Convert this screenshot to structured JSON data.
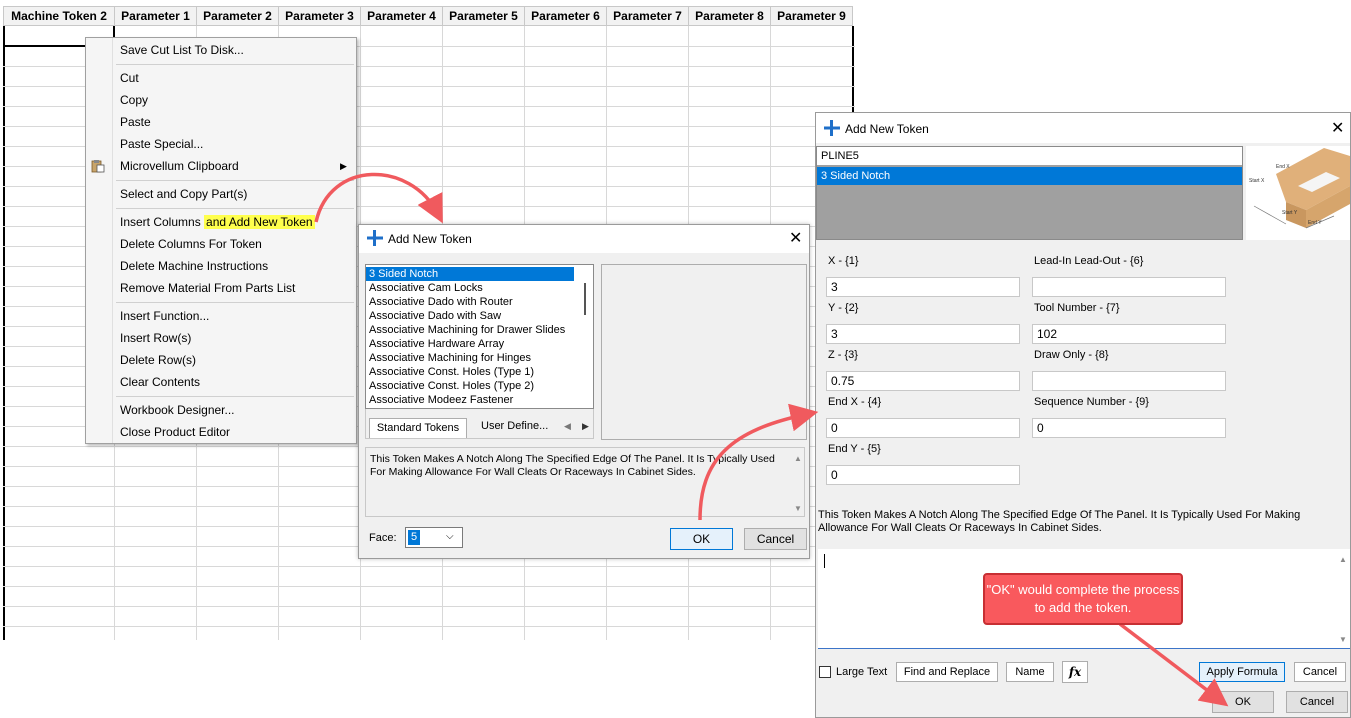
{
  "sheet": {
    "headers": [
      "Machine Token 2",
      "Parameter 1",
      "Parameter 2",
      "Parameter 3",
      "Parameter 4",
      "Parameter 5",
      "Parameter 6",
      "Parameter 7",
      "Parameter 8",
      "Parameter 9"
    ]
  },
  "context_menu": {
    "items": [
      "Save Cut List To Disk...",
      "Cut",
      "Copy",
      "Paste",
      "Paste Special...",
      "Microvellum Clipboard",
      "Select and Copy Part(s)",
      "Insert Columns ",
      "and Add New Token",
      "Delete Columns For Token",
      "Delete Machine Instructions",
      "Remove Material From Parts List",
      "Insert Function...",
      "Insert Row(s)",
      "Delete Row(s)",
      "Clear Contents",
      "Workbook Designer...",
      "Close Product Editor"
    ]
  },
  "dialog1": {
    "title": "Add New Token",
    "close": "✕",
    "tokens": [
      "3 Sided Notch",
      "Associative Cam Locks",
      "Associative Dado with Router",
      "Associative Dado with Saw",
      "Associative Machining for Drawer Slides",
      "Associative Hardware Array",
      "Associative Machining for Hinges",
      "Associative Const. Holes (Type 1)",
      "Associative Const. Holes (Type 2)",
      "Associative Modeez Fastener"
    ],
    "tab_standard": "Standard Tokens",
    "tab_user": "User Define...",
    "description": "This Token Makes A Notch Along The Specified Edge Of The Panel. It Is Typically Used For Making Allowance For Wall Cleats Or Raceways In Cabinet Sides.",
    "face_label": "Face:",
    "face_value": "5",
    "ok": "OK",
    "cancel": "Cancel"
  },
  "dialog2": {
    "title": "Add New Token",
    "close": "✕",
    "list": [
      "PLINE5",
      "3 Sided Notch"
    ],
    "fields_left": [
      {
        "label": "X - {1}",
        "value": "3"
      },
      {
        "label": "Y - {2}",
        "value": "3"
      },
      {
        "label": "Z - {3}",
        "value": "0.75"
      },
      {
        "label": "End X - {4}",
        "value": "0"
      },
      {
        "label": "End Y - {5}",
        "value": "0"
      }
    ],
    "fields_right": [
      {
        "label": "Lead-In Lead-Out - {6}",
        "value": ""
      },
      {
        "label": "Tool Number - {7}",
        "value": "102"
      },
      {
        "label": "Draw Only - {8}",
        "value": ""
      },
      {
        "label": "Sequence Number - {9}",
        "value": "0"
      }
    ],
    "description": "This Token Makes A Notch Along The Specified Edge Of The Panel. It Is Typically Used For Making Allowance For Wall Cleats Or Raceways In Cabinet Sides.",
    "large_text": "Large Text",
    "find_replace": "Find and Replace",
    "name": "Name",
    "fx": "fx",
    "apply_formula": "Apply Formula",
    "cancel_small": "Cancel",
    "ok": "OK",
    "cancel": "Cancel",
    "preview_labels": [
      "End X",
      "Start X",
      "Start Y",
      "End Y"
    ]
  },
  "callout": {
    "text": "\"OK\" would complete the process to add the token."
  },
  "colors": {
    "selection": "#0078d7",
    "highlight": "#ffff4d",
    "arrow": "#f05a5e",
    "callout_bg": "#f9595d"
  }
}
